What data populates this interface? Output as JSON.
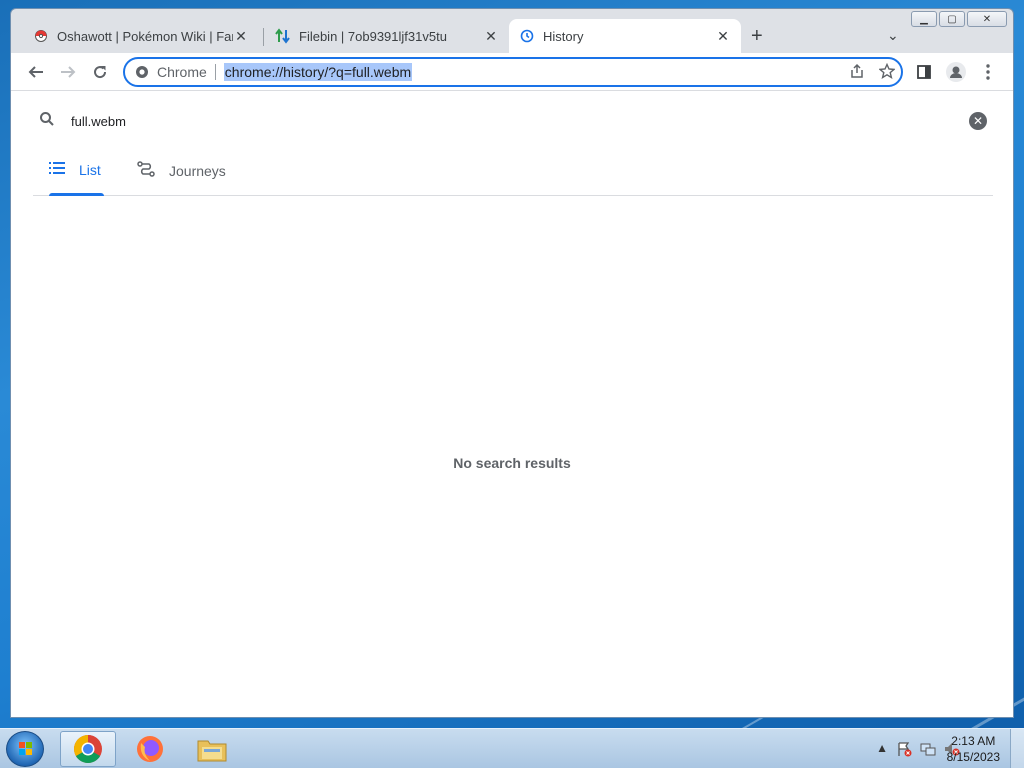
{
  "browser": {
    "tabs": [
      {
        "title": "Oshawott | Pokémon Wiki | Fandom",
        "close": "✕"
      },
      {
        "title": "Filebin | 7ob9391ljf31v5tu",
        "close": "✕"
      },
      {
        "title": "History",
        "close": "✕"
      }
    ],
    "new_tab": "+",
    "tab_search": "⌄",
    "omnibox": {
      "chip": "Chrome",
      "url": "chrome://history/?q=full.webm"
    }
  },
  "history": {
    "search_query": "full.webm",
    "tabs": [
      {
        "label": "List"
      },
      {
        "label": "Journeys"
      }
    ],
    "empty_message": "No search results"
  },
  "taskbar": {
    "clock_time": "2:13 AM",
    "clock_date": "8/15/2023"
  },
  "colors": {
    "accent": "#1a73e8"
  }
}
